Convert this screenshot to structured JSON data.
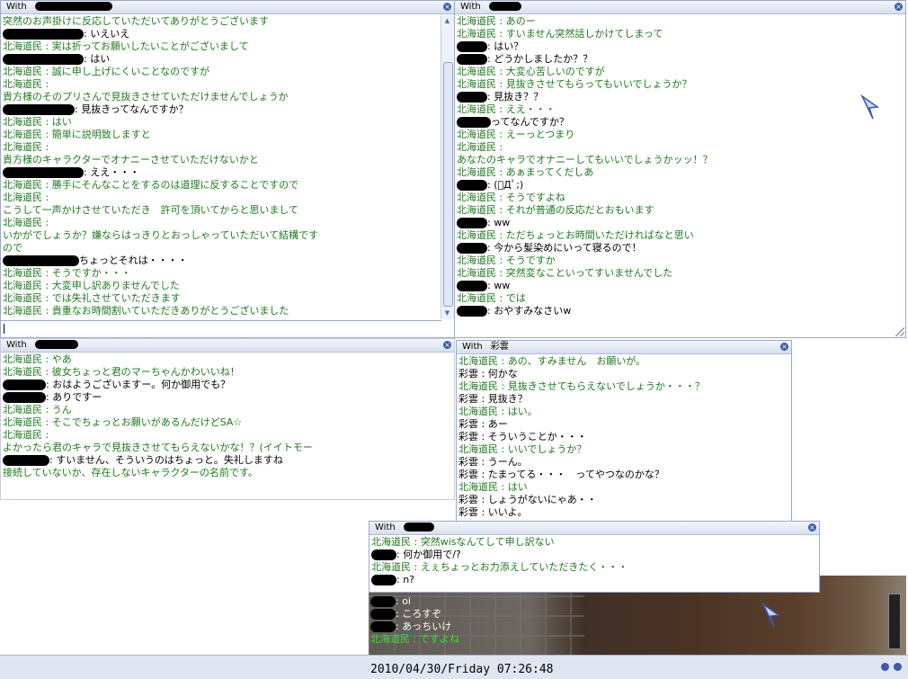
{
  "colors": {
    "npc": "#1d7a1d",
    "text": "#000000",
    "accent": "#3a5aa8"
  },
  "w1": {
    "title": "With",
    "lines": [
      {
        "c": "g",
        "t": "突然のお声掛けに反応していただいてありがとうございます"
      },
      {
        "c": "b",
        "r": 90,
        "t": ": いえいえ"
      },
      {
        "c": "g",
        "t": "北海道民 : 実は折ってお願いしたいことがございまして"
      },
      {
        "c": "b",
        "r": 90,
        "t": ": はい"
      },
      {
        "c": "g",
        "t": "北海道民 : 誠に申し上げにくいことなのですが"
      },
      {
        "c": "g",
        "t": "北海道民 :"
      },
      {
        "c": "g",
        "t": "貴方様のそのプリさんで見抜きさせていただけませんでしょうか"
      },
      {
        "c": "b",
        "r": 80,
        "t": ": 見抜きってなんですか？"
      },
      {
        "c": "g",
        "t": "北海道民 : はい"
      },
      {
        "c": "g",
        "t": "北海道民 : 簡単に説明致しますと"
      },
      {
        "c": "g",
        "t": "北海道民 :"
      },
      {
        "c": "g",
        "t": "貴方様のキャラクターでオナニーさせていただけないかと"
      },
      {
        "c": "b",
        "r": 90,
        "t": ": ええ・・・"
      },
      {
        "c": "g",
        "t": "北海道民 : 勝手にそんなことをするのは道理に反することですので"
      },
      {
        "c": "g",
        "t": "北海道民 :"
      },
      {
        "c": "g",
        "t": "こうして一声かけさせていただき　許可を頂いてからと思いまして"
      },
      {
        "c": "g",
        "t": "北海道民 :"
      },
      {
        "c": "g",
        "t": "いかがでしょうか？嫌ならはっきりとおっしゃっていただいて結構です"
      },
      {
        "c": "g",
        "t": "ので"
      },
      {
        "c": "b",
        "r": 85,
        "t": "ちょっとそれは・・・・"
      },
      {
        "c": "g",
        "t": "北海道民 : そうですか・・・"
      },
      {
        "c": "g",
        "t": "北海道民 : 大変申し訳ありませんでした"
      },
      {
        "c": "g",
        "t": "北海道民 : では失礼させていただきます"
      },
      {
        "c": "g",
        "t": "北海道民 : 貴重なお時間割いていただきありがとうございました"
      }
    ]
  },
  "w2": {
    "title": "With",
    "lines": [
      {
        "c": "g",
        "t": "北海道民 : あのー"
      },
      {
        "c": "g",
        "t": "北海道民 : すいません突然話しかけてしまって"
      },
      {
        "c": "b",
        "r": 34,
        "t": ": はい？"
      },
      {
        "c": "b",
        "r": 34,
        "t": ": どうかしましたか？？"
      },
      {
        "c": "g",
        "t": "北海道民 : 大変心苦しいのですが"
      },
      {
        "c": "g",
        "t": "北海道民 : 見抜きさせてもらってもいいでしょうか？"
      },
      {
        "c": "b",
        "r": 34,
        "t": ": 見抜き？？"
      },
      {
        "c": "g",
        "t": "北海道民 : ええ・・・"
      },
      {
        "c": "b",
        "r": 38,
        "t": "ってなんですか？"
      },
      {
        "c": "g",
        "t": "北海道民 : えーっとつまり"
      },
      {
        "c": "g",
        "t": "北海道民 :"
      },
      {
        "c": "g",
        "t": "あなたのキャラでオナニーしてもいいでしょうかッッ！？"
      },
      {
        "c": "g",
        "t": "北海道民 : あぁまってくだしあ"
      },
      {
        "c": "b",
        "r": 34,
        "t": ": (ﾟДﾟ;)"
      },
      {
        "c": "g",
        "t": "北海道民 : そうですよね"
      },
      {
        "c": "g",
        "t": "北海道民 : それが普通の反応だとおもいます"
      },
      {
        "c": "b",
        "r": 34,
        "t": ": ww"
      },
      {
        "c": "g",
        "t": "北海道民 : ただちょっとお時間いただければなと思い"
      },
      {
        "c": "b",
        "r": 34,
        "t": ": 今から髪染めにいって寝るので！"
      },
      {
        "c": "g",
        "t": "北海道民 : そうですか"
      },
      {
        "c": "g",
        "t": "北海道民 : 突然変なこといってすいませんでした"
      },
      {
        "c": "b",
        "r": 34,
        "t": ": ww"
      },
      {
        "c": "g",
        "t": "北海道民 : では"
      },
      {
        "c": "b",
        "r": 34,
        "t": ": おやすみなさいw"
      }
    ]
  },
  "w3": {
    "title": "With",
    "lines": [
      {
        "c": "g",
        "t": "北海道民 : やあ"
      },
      {
        "c": "g",
        "t": "北海道民 : 彼女ちょっと君のマーちゃんかわいいね！"
      },
      {
        "c": "b",
        "r": 48,
        "t": ": おはようございますー。何か御用でも？"
      },
      {
        "c": "b",
        "r": 48,
        "t": ": ありですー"
      },
      {
        "c": "g",
        "t": "北海道民 : うん"
      },
      {
        "c": "g",
        "t": "北海道民 : そこでちょっとお願いがあるんだけどSA☆"
      },
      {
        "c": "g",
        "t": "北海道民 :"
      },
      {
        "c": "g",
        "t": "よかったら君のキャラで見抜きさせてもらえないかな！？(イイトモー"
      },
      {
        "c": "b",
        "r": 52,
        "t": ": すいません、そういうのはちょっと。失礼しますね"
      },
      {
        "c": "g",
        "t": "接続していないか、存在しないキャラクターの名前です。"
      }
    ]
  },
  "w4": {
    "title": "With",
    "name": "彩雲",
    "lines": [
      {
        "c": "g",
        "t": "北海道民 : あの、すみません　お願いが。"
      },
      {
        "c": "b",
        "t": "彩雲 : 何かな"
      },
      {
        "c": "g",
        "t": "北海道民 : 見抜きさせてもらえないでしょうか・・・？"
      },
      {
        "c": "b",
        "t": "彩雲 : 見抜き？"
      },
      {
        "c": "g",
        "t": "北海道民 : はい。"
      },
      {
        "c": "b",
        "t": "彩雲 : あー"
      },
      {
        "c": "b",
        "t": "彩雲 : そういうことか・・・"
      },
      {
        "c": "g",
        "t": "北海道民 : いいでしょうか？"
      },
      {
        "c": "b",
        "t": "彩雲 : うーん。"
      },
      {
        "c": "b",
        "t": "彩雲 : たまってる・・・　ってやつなのかな？"
      },
      {
        "c": "g",
        "t": "北海道民 : はい"
      },
      {
        "c": "b",
        "t": "彩雲 : しょうがないにゃあ・・"
      },
      {
        "c": "b",
        "t": "彩雲 : いいよ。"
      }
    ]
  },
  "w5": {
    "title": "With",
    "lines": [
      {
        "c": "g",
        "t": "北海道民 : 突然wisなんてして申し訳ない"
      },
      {
        "c": "b",
        "r": 28,
        "t": ": 何か御用で/?"
      },
      {
        "c": "g",
        "t": "北海道民 : えぇちょっとお力添えしていただきたく・・・"
      },
      {
        "c": "b",
        "r": 28,
        "t": ": n?"
      }
    ]
  },
  "game": {
    "lines": [
      {
        "c": "w",
        "t": ": oi"
      },
      {
        "c": "w",
        "t": ": ころすぞ"
      },
      {
        "c": "w",
        "t": ": あっちいけ"
      },
      {
        "c": "gg",
        "t": "北海道民 : ですよね"
      }
    ]
  },
  "taskbar": {
    "clock": "2010/04/30/Friday  07:26:48"
  }
}
